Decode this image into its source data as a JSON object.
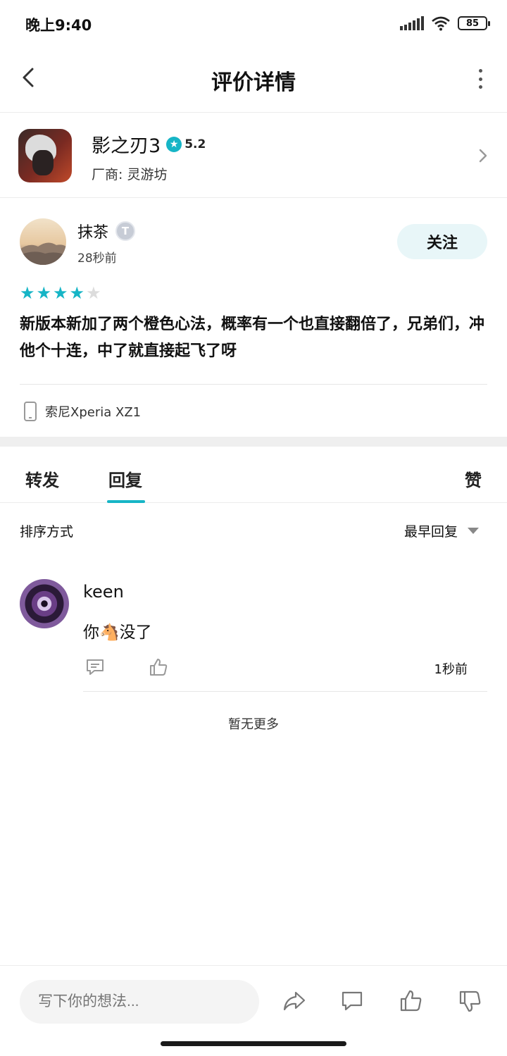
{
  "status": {
    "time": "晚上9:40",
    "battery": "85"
  },
  "nav": {
    "title": "评价详情"
  },
  "game": {
    "name": "影之刃3",
    "rating": "5.2",
    "vendor": "厂商: 灵游坊"
  },
  "review": {
    "user": "抹茶",
    "level": "T",
    "time": "28秒前",
    "follow_label": "关注",
    "stars": 4,
    "stars_max": 5,
    "text": "新版本新加了两个橙色心法，概率有一个也直接翻倍了，兄弟们，冲他个十连，中了就直接起飞了呀",
    "device": "索尼Xperia XZ1"
  },
  "tabs": {
    "forward": "转发",
    "reply": "回复",
    "like": "赞"
  },
  "sort": {
    "label": "排序方式",
    "value": "最早回复"
  },
  "comment": {
    "user": "keen",
    "text": "你🐴没了",
    "time": "1秒前"
  },
  "list_end": "暂无更多",
  "bottom": {
    "placeholder": "写下你的想法..."
  },
  "colors": {
    "accent": "#16b5c6"
  }
}
